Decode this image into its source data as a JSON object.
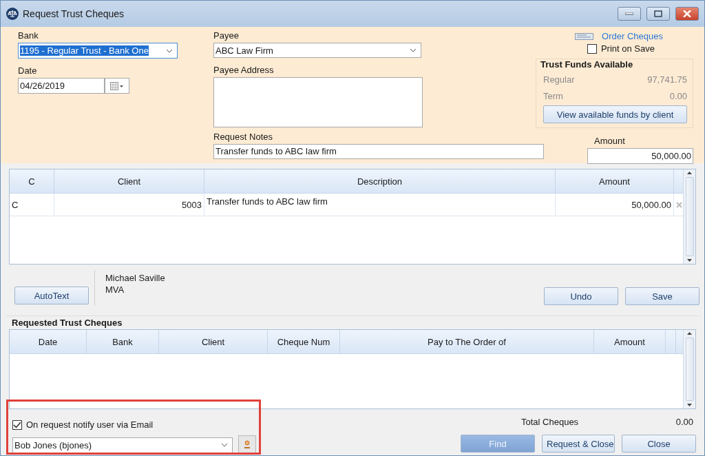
{
  "window": {
    "title": "Request Trust Cheques"
  },
  "form": {
    "bank": {
      "label": "Bank",
      "value": "1195 - Regular Trust - Bank One",
      "selected": true
    },
    "date": {
      "label": "Date",
      "value": "04/26/2019"
    },
    "payee": {
      "label": "Payee",
      "value": "ABC Law Firm"
    },
    "payee_address": {
      "label": "Payee Address"
    },
    "request_notes": {
      "label": "Request Notes",
      "value": "Transfer funds to ABC law firm"
    },
    "order_cheques": "Order Cheques",
    "print_on_save": {
      "label": "Print on Save",
      "checked": false
    },
    "trust_funds": {
      "title": "Trust Funds Available",
      "rows": [
        {
          "label": "Regular",
          "value": "97,741.75"
        },
        {
          "label": "Term",
          "value": "0.00"
        }
      ],
      "button": "View available funds by client"
    },
    "amount": {
      "label": "Amount",
      "value": "50,000.00"
    }
  },
  "lines_table": {
    "columns": [
      "C",
      "Client",
      "Description",
      "Amount"
    ],
    "rows": [
      [
        "C",
        "5003",
        "Transfer funds to ABC law firm",
        "50,000.00"
      ]
    ]
  },
  "autotext_button": "AutoText",
  "client_info": [
    "Michael Saville",
    "MVA"
  ],
  "edit_buttons": [
    "Undo",
    "Save"
  ],
  "requested": {
    "title": "Requested Trust Cheques",
    "columns": [
      "Date",
      "Bank",
      "Client",
      "Cheque Num",
      "Pay to The Order of",
      "Amount"
    ]
  },
  "notify": {
    "label": "On request notify user via Email",
    "checked": true,
    "user": "Bob Jones (bjones)"
  },
  "total": {
    "label": "Total Cheques",
    "value": "0.00"
  },
  "footer_buttons": [
    {
      "label": "Find",
      "highlighted": true
    },
    {
      "label": "Request & Close",
      "highlighted": false
    },
    {
      "label": "Close",
      "highlighted": false
    }
  ]
}
